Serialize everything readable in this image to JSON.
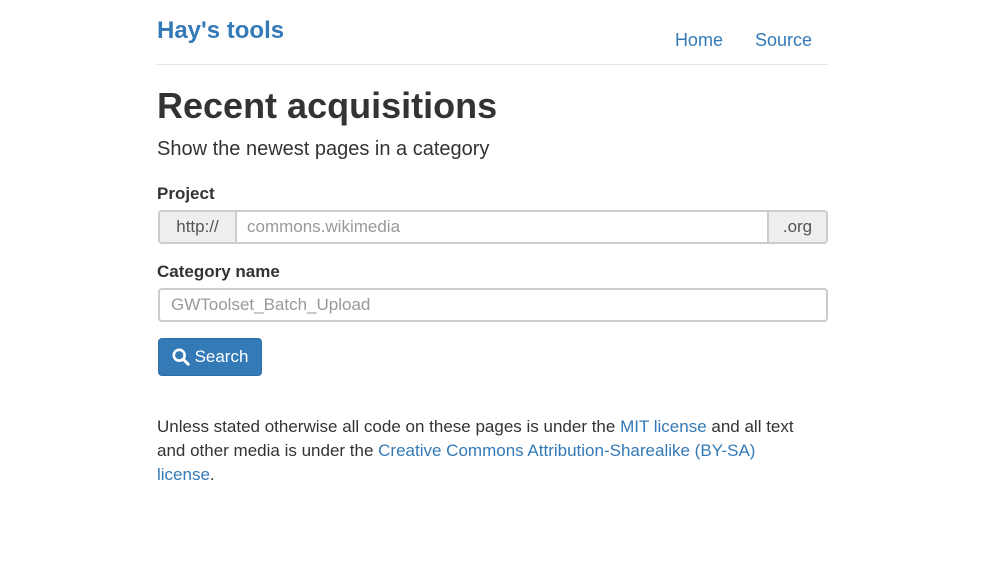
{
  "header": {
    "brand": "Hay's tools",
    "nav": [
      {
        "label": "Home"
      },
      {
        "label": "Source"
      }
    ]
  },
  "main": {
    "title": "Recent acquisitions",
    "subtitle": "Show the newest pages in a category",
    "project": {
      "label": "Project",
      "prefix": "http://",
      "placeholder": "commons.wikimedia",
      "value": "",
      "suffix": ".org"
    },
    "category": {
      "label": "Category name",
      "placeholder": "GWToolset_Batch_Upload",
      "value": ""
    },
    "search_button": {
      "label": "Search",
      "icon": "search-icon"
    }
  },
  "footer": {
    "text_before": "Unless stated otherwise all code on these pages is under the ",
    "mit_link": "MIT license",
    "text_middle": " and all text and other media is under the ",
    "cc_link": "Creative Commons Attribution-Sharealike (BY-SA) license",
    "text_after": "."
  },
  "colors": {
    "link": "#337ab7",
    "button": "#337ab7",
    "text": "#333333",
    "border": "#cccccc",
    "addon_bg": "#eeeeee"
  }
}
